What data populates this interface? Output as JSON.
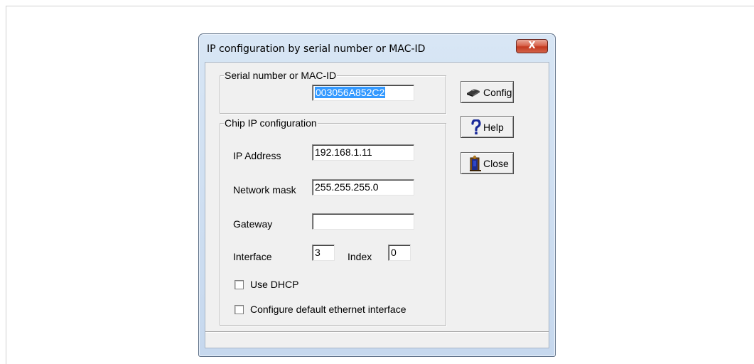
{
  "dialog": {
    "title": "IP configuration by serial number or MAC-ID",
    "close_symbol": "X"
  },
  "serial": {
    "group_label": "Serial number or MAC-ID",
    "value": "003056A852C2"
  },
  "chip": {
    "group_label": "Chip IP configuration",
    "ip_label": "IP Address",
    "ip_value": "192.168.1.11",
    "mask_label": "Network mask",
    "mask_value": "255.255.255.0",
    "gateway_label": "Gateway",
    "gateway_value": "",
    "interface_label": "Interface",
    "interface_value": "3",
    "index_label": "Index",
    "index_value": "0",
    "dhcp_label": "Use DHCP",
    "dhcp_checked": false,
    "default_eth_label": "Configure default ethernet interface",
    "default_eth_checked": false
  },
  "buttons": {
    "config": {
      "label": "Config",
      "icon": "chip-icon"
    },
    "help": {
      "label": "Help",
      "icon": "question-icon"
    },
    "close": {
      "label": "Close",
      "icon": "door-icon"
    }
  },
  "colors": {
    "selection": "#3399ff",
    "close_button": "#c3391f"
  }
}
